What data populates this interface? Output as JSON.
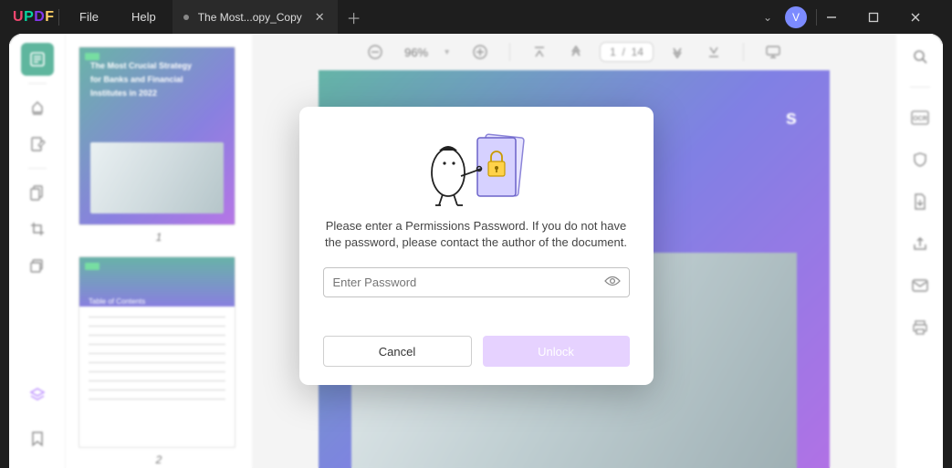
{
  "app": {
    "logo": {
      "u": "U",
      "p": "P",
      "d": "D",
      "f": "F"
    }
  },
  "menu": {
    "file": "File",
    "help": "Help"
  },
  "tab": {
    "title": "The Most...opy_Copy"
  },
  "avatar": {
    "initial": "V"
  },
  "toolbar": {
    "zoom": "96%",
    "page_current": "1",
    "page_sep": "/",
    "page_total": "14"
  },
  "thumbs": {
    "page1_num": "1",
    "page2_num": "2",
    "cover_line1": "The Most Crucial Strategy",
    "cover_line2": "for Banks and Financial",
    "cover_line3": "Institutes in 2022",
    "toc_title": "Table of Contents"
  },
  "doc": {
    "line3": "s"
  },
  "modal": {
    "message": "Please enter a Permissions Password. If you do not have the password, please contact the author of the document.",
    "placeholder": "Enter Password",
    "cancel": "Cancel",
    "unlock": "Unlock"
  }
}
